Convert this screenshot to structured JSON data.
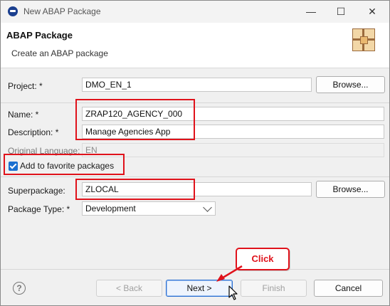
{
  "window": {
    "title": "New ABAP Package",
    "minimize_glyph": "—",
    "maximize_glyph": "☐",
    "close_glyph": "✕"
  },
  "header": {
    "title": "ABAP Package",
    "subtitle": "Create an ABAP package",
    "icon": "package-wizard-icon"
  },
  "form": {
    "project": {
      "label": "Project: *",
      "value": "DMO_EN_1",
      "browse_label": "Browse..."
    },
    "name": {
      "label": "Name: *",
      "value": "ZRAP120_AGENCY_000"
    },
    "description": {
      "label": "Description: *",
      "value": "Manage Agencies App"
    },
    "original_language": {
      "label": "Original Language:",
      "value": "EN"
    },
    "favorite": {
      "label": "Add to favorite packages",
      "checked": true
    },
    "superpackage": {
      "label": "Superpackage:",
      "value": "ZLOCAL",
      "browse_label": "Browse..."
    },
    "package_type": {
      "label": "Package Type: *",
      "value": "Development"
    }
  },
  "footer": {
    "help_glyph": "?",
    "back_label": "< Back",
    "next_label": "Next >",
    "finish_label": "Finish",
    "cancel_label": "Cancel"
  },
  "annotation": {
    "callout_label": "Click",
    "highlight_color": "#e0121b"
  }
}
